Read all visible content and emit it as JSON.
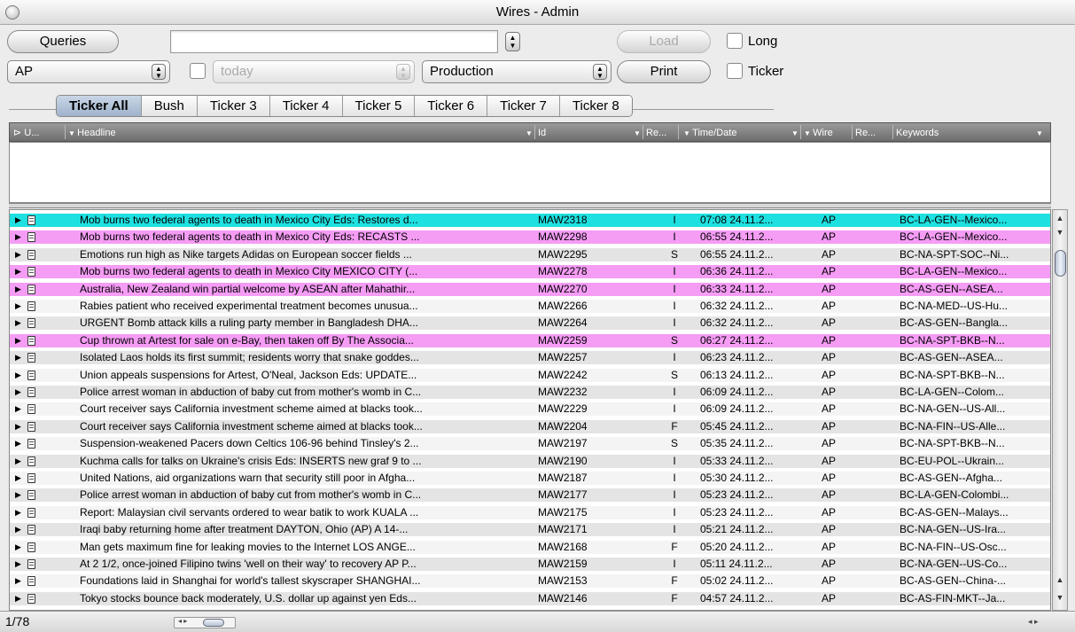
{
  "window": {
    "title": "Wires - Admin"
  },
  "toolbar": {
    "queries_label": "Queries",
    "query_value": "",
    "load_label": "Load",
    "long_label": "Long",
    "source_value": "AP",
    "date_value": "today",
    "env_value": "Production",
    "print_label": "Print",
    "ticker_label": "Ticker"
  },
  "tabs": [
    "Ticker All",
    "Bush",
    "Ticker 3",
    "Ticker 4",
    "Ticker 5",
    "Ticker 6",
    "Ticker 7",
    "Ticker 8"
  ],
  "columns": {
    "urgency": "U...",
    "headline": "Headline",
    "id": "Id",
    "revision": "Re...",
    "time": "Time/Date",
    "wire": "Wire",
    "rel": "Re...",
    "keywords": "Keywords"
  },
  "rows": [
    {
      "headline": "Mob burns two federal agents to death in Mexico City Eds: Restores d...",
      "id": "MAW2318",
      "rev": "I",
      "time": "07:08 24.11.2...",
      "wire": "AP",
      "kw": "BC-LA-GEN--Mexico...",
      "hl": "cyan"
    },
    {
      "headline": "Mob burns two federal agents to death in Mexico City Eds: RECASTS ...",
      "id": "MAW2298",
      "rev": "I",
      "time": "06:55 24.11.2...",
      "wire": "AP",
      "kw": "BC-LA-GEN--Mexico...",
      "hl": "pink"
    },
    {
      "headline": "Emotions run high as Nike targets Adidas on European soccer fields ...",
      "id": "MAW2295",
      "rev": "S",
      "time": "06:55 24.11.2...",
      "wire": "AP",
      "kw": "BC-NA-SPT-SOC--Ni...",
      "hl": ""
    },
    {
      "headline": "Mob burns two federal agents to death in Mexico City MEXICO CITY (...",
      "id": "MAW2278",
      "rev": "I",
      "time": "06:36 24.11.2...",
      "wire": "AP",
      "kw": "BC-LA-GEN--Mexico...",
      "hl": "pink"
    },
    {
      "headline": "Australia, New Zealand win partial welcome by ASEAN after Mahathir...",
      "id": "MAW2270",
      "rev": "I",
      "time": "06:33 24.11.2...",
      "wire": "AP",
      "kw": "BC-AS-GEN--ASEA...",
      "hl": "pink"
    },
    {
      "headline": "Rabies patient who received experimental treatment becomes unusua...",
      "id": "MAW2266",
      "rev": "I",
      "time": "06:32 24.11.2...",
      "wire": "AP",
      "kw": "BC-NA-MED--US-Hu...",
      "hl": ""
    },
    {
      "headline": "URGENT Bomb attack kills a ruling party member in Bangladesh DHA...",
      "id": "MAW2264",
      "rev": "I",
      "time": "06:32 24.11.2...",
      "wire": "AP",
      "kw": "BC-AS-GEN--Bangla...",
      "hl": ""
    },
    {
      "headline": "Cup thrown at Artest for sale on e-Bay, then taken off By The Associa...",
      "id": "MAW2259",
      "rev": "S",
      "time": "06:27 24.11.2...",
      "wire": "AP",
      "kw": "BC-NA-SPT-BKB--N...",
      "hl": "pink"
    },
    {
      "headline": "Isolated Laos holds its first summit; residents worry that snake goddes...",
      "id": "MAW2257",
      "rev": "I",
      "time": "06:23 24.11.2...",
      "wire": "AP",
      "kw": "BC-AS-GEN--ASEA...",
      "hl": ""
    },
    {
      "headline": "Union appeals suspensions for Artest, O'Neal, Jackson Eds: UPDATE...",
      "id": "MAW2242",
      "rev": "S",
      "time": "06:13 24.11.2...",
      "wire": "AP",
      "kw": "BC-NA-SPT-BKB--N...",
      "hl": ""
    },
    {
      "headline": "Police arrest woman in abduction of baby cut from mother's womb in C...",
      "id": "MAW2232",
      "rev": "I",
      "time": "06:09 24.11.2...",
      "wire": "AP",
      "kw": "BC-LA-GEN--Colom...",
      "hl": ""
    },
    {
      "headline": "Court receiver says California investment scheme aimed at blacks took...",
      "id": "MAW2229",
      "rev": "I",
      "time": "06:09 24.11.2...",
      "wire": "AP",
      "kw": "BC-NA-GEN--US-All...",
      "hl": ""
    },
    {
      "headline": "Court receiver says California investment scheme aimed at blacks took...",
      "id": "MAW2204",
      "rev": "F",
      "time": "05:45 24.11.2...",
      "wire": "AP",
      "kw": "BC-NA-FIN--US-Alle...",
      "hl": ""
    },
    {
      "headline": "Suspension-weakened Pacers down Celtics 106-96 behind Tinsley's 2...",
      "id": "MAW2197",
      "rev": "S",
      "time": "05:35 24.11.2...",
      "wire": "AP",
      "kw": "BC-NA-SPT-BKB--N...",
      "hl": ""
    },
    {
      "headline": "Kuchma calls for talks on Ukraine's crisis Eds: INSERTS new graf 9 to ...",
      "id": "MAW2190",
      "rev": "I",
      "time": "05:33 24.11.2...",
      "wire": "AP",
      "kw": "BC-EU-POL--Ukrain...",
      "hl": ""
    },
    {
      "headline": "United Nations, aid organizations warn that security still poor in Afgha...",
      "id": "MAW2187",
      "rev": "I",
      "time": "05:30 24.11.2...",
      "wire": "AP",
      "kw": "BC-AS-GEN--Afgha...",
      "hl": ""
    },
    {
      "headline": "Police arrest woman in abduction of baby cut from mother's womb in C...",
      "id": "MAW2177",
      "rev": "I",
      "time": "05:23 24.11.2...",
      "wire": "AP",
      "kw": "BC-LA-GEN-Colombi...",
      "hl": ""
    },
    {
      "headline": "Report: Malaysian civil servants ordered to wear batik to work KUALA ...",
      "id": "MAW2175",
      "rev": "I",
      "time": "05:23 24.11.2...",
      "wire": "AP",
      "kw": "BC-AS-GEN--Malays...",
      "hl": ""
    },
    {
      "headline": "Iraqi baby returning home after treatment DAYTON, Ohio (AP)   A 14-...",
      "id": "MAW2171",
      "rev": "I",
      "time": "05:21 24.11.2...",
      "wire": "AP",
      "kw": "BC-NA-GEN--US-Ira...",
      "hl": ""
    },
    {
      "headline": "Man gets maximum fine for leaking movies to the Internet LOS ANGE...",
      "id": "MAW2168",
      "rev": "F",
      "time": "05:20 24.11.2...",
      "wire": "AP",
      "kw": "BC-NA-FIN--US-Osc...",
      "hl": ""
    },
    {
      "headline": "At 2 1/2, once-joined Filipino twins 'well on their way' to recovery AP P...",
      "id": "MAW2159",
      "rev": "I",
      "time": "05:11 24.11.2...",
      "wire": "AP",
      "kw": "BC-NA-GEN--US-Co...",
      "hl": ""
    },
    {
      "headline": "Foundations laid in Shanghai for world's tallest skyscraper SHANGHAI...",
      "id": "MAW2153",
      "rev": "F",
      "time": "05:02 24.11.2...",
      "wire": "AP",
      "kw": "BC-AS-GEN--China-...",
      "hl": ""
    },
    {
      "headline": "Tokyo stocks bounce back moderately, U.S. dollar up against yen Eds...",
      "id": "MAW2146",
      "rev": "F",
      "time": "04:57 24.11.2...",
      "wire": "AP",
      "kw": "BC-AS-FIN-MKT--Ja...",
      "hl": ""
    }
  ],
  "status": {
    "count": "1/78"
  },
  "colors": {
    "highlight_cyan": "#1fe0e0",
    "highlight_pink": "#f59cf5",
    "header_gray": "#7e7e7e"
  }
}
